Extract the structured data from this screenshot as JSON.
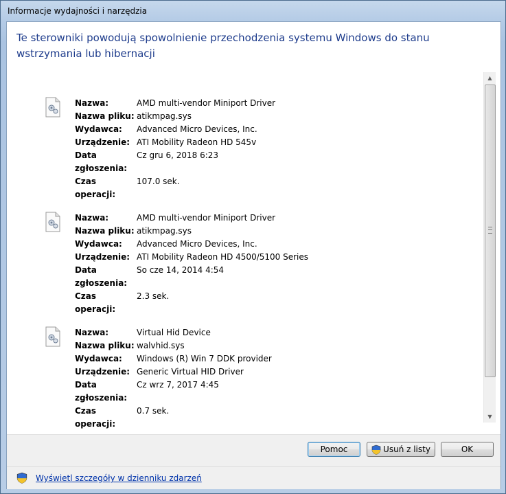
{
  "window": {
    "title": "Informacje wydajności i narzędzia"
  },
  "heading": "Te sterowniki powodują spowolnienie przechodzenia systemu Windows do stanu wstrzymania lub hibernacji",
  "labels": {
    "name": "Nazwa:",
    "file": "Nazwa pliku:",
    "publisher": "Wydawca:",
    "device": "Urządzenie:",
    "reported": "Data zgłoszenia:",
    "time": "Czas operacji:"
  },
  "drivers": [
    {
      "icon": "driver-file-icon",
      "name": "AMD multi-vendor Miniport Driver",
      "file": "atikmpag.sys",
      "publisher": "Advanced Micro Devices, Inc.",
      "device": "ATI Mobility Radeon HD 545v",
      "reported": "Cz gru 6, 2018 6:23",
      "time": "107.0 sek."
    },
    {
      "icon": "driver-file-icon",
      "name": "AMD multi-vendor Miniport Driver",
      "file": "atikmpag.sys",
      "publisher": "Advanced Micro Devices, Inc.",
      "device": "ATI Mobility Radeon HD 4500/5100 Series",
      "reported": "So cze 14, 2014 4:54",
      "time": "2.3 sek."
    },
    {
      "icon": "driver-file-icon",
      "name": "Virtual Hid Device",
      "file": "walvhid.sys",
      "publisher": "Windows (R) Win 7 DDK provider",
      "device": "Generic Virtual HID Driver",
      "reported": "Cz wrz 7, 2017 4:45",
      "time": "0.7 sek."
    }
  ],
  "buttons": {
    "help": "Pomoc",
    "remove": "Usuń z listy",
    "ok": "OK"
  },
  "footer_link": "Wyświetl szczegóły w dzienniku zdarzeń",
  "icons": {
    "scroll_up": "scroll-up-arrow-icon",
    "scroll_down": "scroll-down-arrow-icon",
    "shield": "uac-shield-icon"
  },
  "colors": {
    "heading": "#1e3c8c",
    "link": "#0033aa"
  }
}
